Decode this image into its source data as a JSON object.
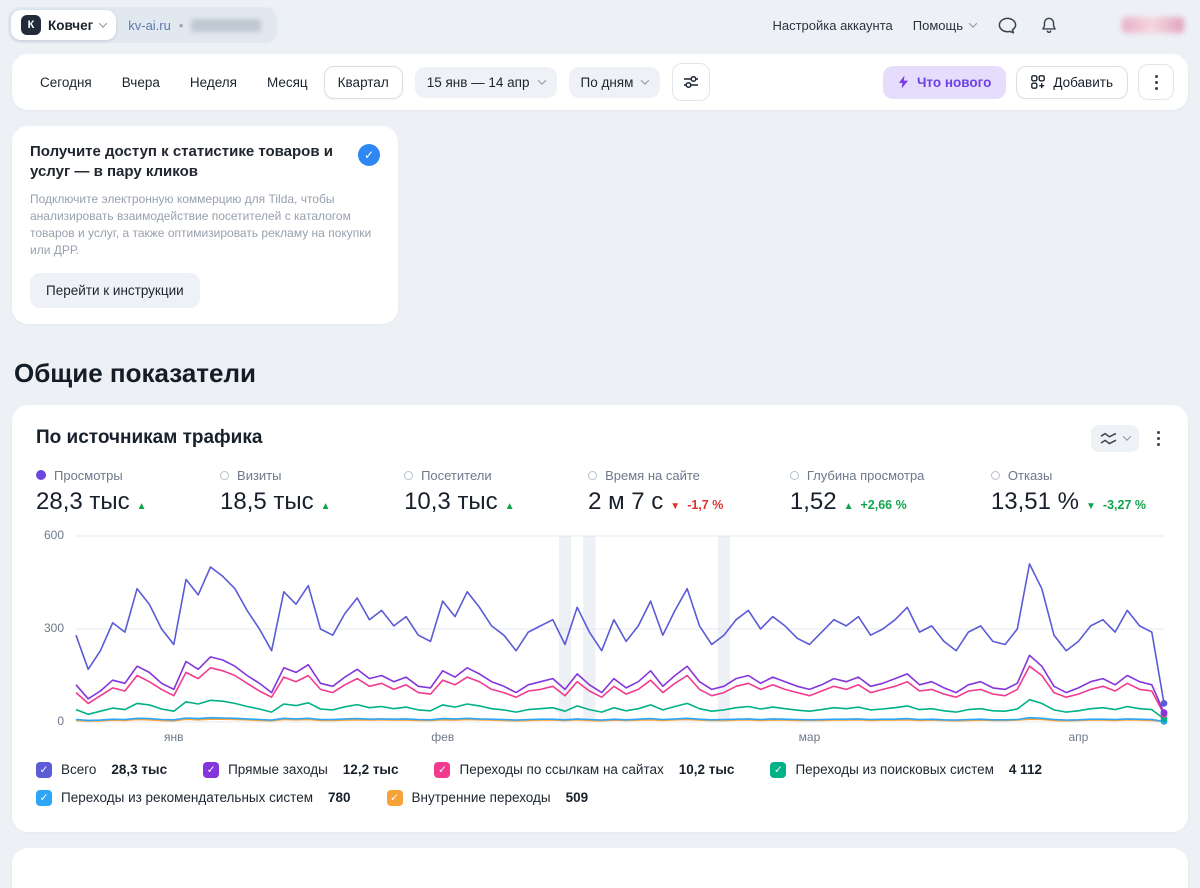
{
  "header": {
    "counter_name": "Ковчег",
    "counter_logo_letter": "К",
    "site": "kv-ai.ru",
    "separator": "•",
    "account_settings": "Настройка аккаунта",
    "help": "Помощь"
  },
  "toolbar": {
    "period_tabs": [
      {
        "label": "Сегодня",
        "selected": false
      },
      {
        "label": "Вчера",
        "selected": false
      },
      {
        "label": "Неделя",
        "selected": false
      },
      {
        "label": "Месяц",
        "selected": false
      },
      {
        "label": "Квартал",
        "selected": true
      }
    ],
    "date_range": "15 янв — 14 апр",
    "grouping": "По дням",
    "whats_new": "Что нового",
    "add": "Добавить"
  },
  "promo": {
    "title": "Получите доступ к статистике товаров и услуг — в пару кликов",
    "body": "Подключите электронную коммерцию для Tilda, чтобы анализировать взаимодействие посетителей с каталогом товаров и услуг, а также оптимизировать рекламу на покупки или ДРР.",
    "button": "Перейти к инструкции"
  },
  "section_title": "Общие показатели",
  "widget": {
    "title": "По источникам трафика",
    "metrics": [
      {
        "label": "Просмотры",
        "value": "28,3 тыс",
        "arrow": "▲",
        "delta": "",
        "trend": "up",
        "trend_color": "green",
        "selected": true
      },
      {
        "label": "Визиты",
        "value": "18,5 тыс",
        "arrow": "▲",
        "delta": "",
        "trend": "up",
        "trend_color": "green",
        "selected": false
      },
      {
        "label": "Посетители",
        "value": "10,3 тыс",
        "arrow": "▲",
        "delta": "",
        "trend": "up",
        "trend_color": "green",
        "selected": false
      },
      {
        "label": "Время на сайте",
        "value": "2 м 7 с",
        "arrow": "▼",
        "delta": "-1,7 %",
        "trend": "down",
        "trend_color": "red",
        "selected": false
      },
      {
        "label": "Глубина просмотра",
        "value": "1,52",
        "arrow": "▲",
        "delta": "+2,66 %",
        "trend": "up",
        "trend_color": "green",
        "selected": false
      },
      {
        "label": "Отказы",
        "value": "13,51 %",
        "arrow": "▼",
        "delta": "-3,27 %",
        "trend": "down",
        "trend_color": "green",
        "selected": false
      }
    ],
    "legend": [
      {
        "label": "Всего",
        "value": "28,3 тыс",
        "color": "#5b5bd6"
      },
      {
        "label": "Прямые заходы",
        "value": "12,2 тыс",
        "color": "#8336db"
      },
      {
        "label": "Переходы по ссылкам на сайтах",
        "value": "10,2 тыс",
        "color": "#f23b8f"
      },
      {
        "label": "Переходы из поисковых систем",
        "value": "4 112",
        "color": "#00b187"
      },
      {
        "label": "Переходы из рекомендательных систем",
        "value": "780",
        "color": "#2ea6f8"
      },
      {
        "label": "Внутренние переходы",
        "value": "509",
        "color": "#f7a239"
      }
    ]
  },
  "chart_data": {
    "type": "line",
    "title": "По источникам трафика",
    "x_axis": {
      "start": "15 янв",
      "end": "14 апр",
      "month_labels": [
        {
          "label": "янв",
          "index": 8
        },
        {
          "label": "фев",
          "index": 30
        },
        {
          "label": "мар",
          "index": 60
        },
        {
          "label": "апр",
          "index": 82
        }
      ]
    },
    "ylim": [
      0,
      600
    ],
    "yticks": [
      0,
      300,
      600
    ],
    "grid": true,
    "holiday_band_indices": [
      40,
      42,
      53
    ],
    "series": [
      {
        "name": "Всего",
        "color": "#5b5bd6",
        "total": "28,3 тыс",
        "values": [
          280,
          170,
          230,
          320,
          290,
          430,
          380,
          300,
          250,
          460,
          410,
          500,
          470,
          430,
          360,
          300,
          230,
          420,
          380,
          440,
          300,
          280,
          350,
          400,
          330,
          360,
          310,
          340,
          280,
          260,
          390,
          340,
          420,
          370,
          310,
          280,
          230,
          290,
          310,
          330,
          250,
          370,
          290,
          230,
          330,
          260,
          310,
          390,
          280,
          360,
          430,
          310,
          250,
          280,
          330,
          360,
          300,
          340,
          310,
          270,
          250,
          290,
          330,
          310,
          340,
          280,
          300,
          330,
          370,
          290,
          310,
          260,
          230,
          290,
          310,
          260,
          250,
          300,
          510,
          430,
          280,
          230,
          260,
          310,
          330,
          290,
          360,
          310,
          290,
          60
        ]
      },
      {
        "name": "Прямые заходы",
        "color": "#8336db",
        "total": "12,2 тыс",
        "values": [
          120,
          75,
          100,
          135,
          125,
          180,
          160,
          125,
          105,
          195,
          170,
          210,
          200,
          180,
          150,
          125,
          95,
          175,
          160,
          185,
          125,
          115,
          145,
          170,
          140,
          150,
          130,
          145,
          115,
          110,
          165,
          145,
          175,
          155,
          130,
          115,
          95,
          120,
          130,
          140,
          105,
          155,
          120,
          95,
          140,
          110,
          130,
          165,
          115,
          150,
          180,
          130,
          105,
          115,
          140,
          150,
          125,
          145,
          130,
          115,
          105,
          120,
          140,
          130,
          145,
          115,
          125,
          140,
          155,
          120,
          130,
          110,
          95,
          120,
          130,
          110,
          105,
          125,
          215,
          180,
          115,
          95,
          110,
          130,
          140,
          120,
          150,
          130,
          120,
          30
        ]
      },
      {
        "name": "Переходы по ссылкам на сайтах",
        "color": "#f23b8f",
        "total": "10,2 тыс",
        "values": [
          95,
          60,
          85,
          110,
          100,
          150,
          130,
          105,
          85,
          160,
          140,
          175,
          165,
          150,
          125,
          100,
          80,
          145,
          130,
          150,
          105,
          95,
          120,
          140,
          115,
          125,
          105,
          120,
          95,
          90,
          135,
          120,
          145,
          130,
          105,
          95,
          80,
          100,
          105,
          115,
          85,
          130,
          100,
          80,
          115,
          90,
          105,
          135,
          95,
          125,
          150,
          105,
          85,
          95,
          115,
          125,
          105,
          120,
          105,
          95,
          85,
          100,
          115,
          105,
          120,
          95,
          105,
          115,
          130,
          100,
          105,
          90,
          80,
          100,
          105,
          90,
          85,
          105,
          180,
          150,
          95,
          80,
          90,
          105,
          115,
          100,
          125,
          105,
          100,
          25
        ]
      },
      {
        "name": "Переходы из поисковых систем",
        "color": "#00b187",
        "total": "4 112",
        "values": [
          40,
          25,
          35,
          45,
          40,
          60,
          55,
          42,
          35,
          65,
          58,
          70,
          67,
          60,
          50,
          42,
          32,
          58,
          53,
          62,
          42,
          39,
          49,
          56,
          46,
          50,
          43,
          48,
          39,
          36,
          55,
          48,
          58,
          52,
          43,
          39,
          32,
          40,
          43,
          46,
          35,
          52,
          40,
          32,
          46,
          36,
          43,
          55,
          39,
          50,
          60,
          43,
          35,
          39,
          46,
          50,
          42,
          48,
          43,
          38,
          35,
          40,
          46,
          43,
          48,
          39,
          42,
          46,
          52,
          40,
          43,
          36,
          32,
          40,
          43,
          36,
          35,
          42,
          72,
          60,
          39,
          32,
          36,
          43,
          46,
          40,
          50,
          43,
          40,
          10
        ]
      },
      {
        "name": "Переходы из рекомендательных систем",
        "color": "#2ea6f8",
        "total": "780",
        "values": [
          8,
          5,
          6,
          9,
          8,
          12,
          11,
          8,
          7,
          13,
          11,
          14,
          13,
          12,
          10,
          8,
          6,
          12,
          10,
          12,
          8,
          8,
          10,
          11,
          9,
          10,
          9,
          10,
          8,
          7,
          11,
          10,
          12,
          10,
          9,
          8,
          6,
          8,
          9,
          9,
          7,
          10,
          8,
          6,
          9,
          7,
          9,
          11,
          8,
          10,
          12,
          9,
          7,
          8,
          9,
          10,
          8,
          10,
          9,
          8,
          7,
          8,
          9,
          9,
          10,
          8,
          9,
          9,
          11,
          8,
          9,
          7,
          6,
          8,
          9,
          7,
          7,
          8,
          14,
          12,
          8,
          6,
          7,
          9,
          9,
          8,
          10,
          9,
          8,
          2
        ]
      },
      {
        "name": "Внутренние переходы",
        "color": "#f7a239",
        "total": "509",
        "values": [
          5,
          3,
          4,
          6,
          5,
          8,
          7,
          5,
          4,
          9,
          7,
          9,
          9,
          8,
          7,
          5,
          4,
          8,
          7,
          8,
          5,
          5,
          6,
          7,
          6,
          7,
          6,
          6,
          5,
          5,
          7,
          6,
          8,
          7,
          6,
          5,
          4,
          5,
          6,
          6,
          5,
          7,
          5,
          4,
          6,
          5,
          6,
          7,
          5,
          7,
          8,
          6,
          5,
          5,
          6,
          7,
          5,
          6,
          6,
          5,
          5,
          5,
          6,
          6,
          7,
          5,
          6,
          6,
          7,
          5,
          6,
          5,
          4,
          5,
          6,
          5,
          5,
          6,
          9,
          8,
          5,
          4,
          5,
          6,
          6,
          5,
          7,
          6,
          5,
          2
        ]
      }
    ]
  }
}
